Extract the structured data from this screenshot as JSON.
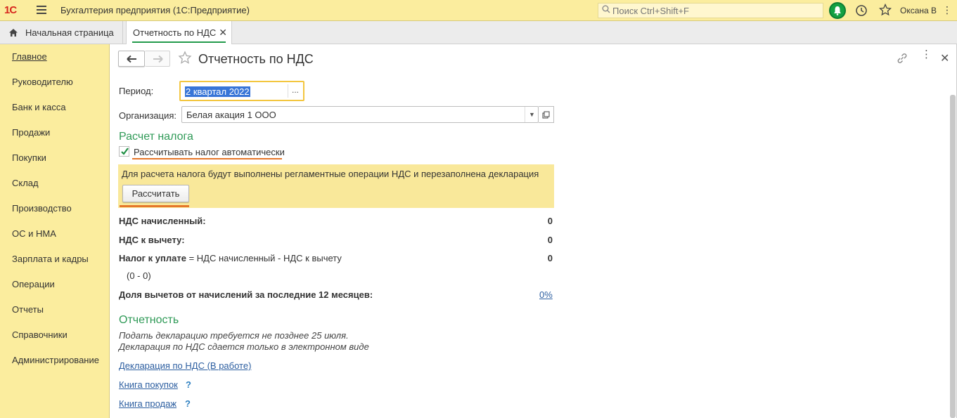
{
  "app": {
    "logo": "1С",
    "title": "Бухгалтерия предприятия  (1С:Предприятие)",
    "search_placeholder": "Поиск Ctrl+Shift+F",
    "user": "Оксана В"
  },
  "tabs": {
    "home": "Начальная страница",
    "active": "Отчетность по НДС"
  },
  "sidebar": {
    "items": [
      {
        "label": "Главное"
      },
      {
        "label": "Руководителю"
      },
      {
        "label": "Банк и касса"
      },
      {
        "label": "Продажи"
      },
      {
        "label": "Покупки"
      },
      {
        "label": "Склад"
      },
      {
        "label": "Производство"
      },
      {
        "label": "ОС и НМА"
      },
      {
        "label": "Зарплата и кадры"
      },
      {
        "label": "Операции"
      },
      {
        "label": "Отчеты"
      },
      {
        "label": "Справочники"
      },
      {
        "label": "Администрирование"
      }
    ]
  },
  "form": {
    "title": "Отчетность по НДС",
    "period_label": "Период:",
    "period_value": "2 квартал 2022",
    "period_btn": "...",
    "org_label": "Организация:",
    "org_value": "Белая акация 1 ООО",
    "calc_section": "Расчет налога",
    "auto_calc_label": "Рассчитывать налог автоматически",
    "auto_calc_checked": true,
    "notice": "Для расчета налога будут выполнены регламентные операции НДС и перезаполнена декларация",
    "calc_button": "Рассчитать",
    "vat_accrued_label": "НДС начисленный:",
    "vat_accrued_value": "0",
    "vat_deduct_label": "НДС к вычету:",
    "vat_deduct_value": "0",
    "tax_payable_label": "Налог к уплате",
    "tax_payable_formula": " = НДС начисленный - НДС к вычету",
    "tax_payable_value": "0",
    "tax_payable_detail": "(0 - 0)",
    "deduct_share_label": "Доля вычетов от начислений за последние 12 месяцев:",
    "deduct_share_value": "0%",
    "reporting_section": "Отчетность",
    "deadline_note": "Подать декларацию требуется не позднее 25 июля.",
    "electronic_note": "Декларация по НДС сдается только в электронном виде",
    "declaration_link": "Декларация по НДС (В работе)",
    "purchase_book_link": "Книга покупок",
    "sales_book_link": "Книга продаж",
    "help_mark": "?"
  },
  "colors": {
    "topbar": "#fbed9e",
    "accent_green": "#2f9a57",
    "highlight_orange": "#e5762a",
    "focus_yellow": "#f3c63f",
    "link_blue": "#2c5ea0"
  }
}
